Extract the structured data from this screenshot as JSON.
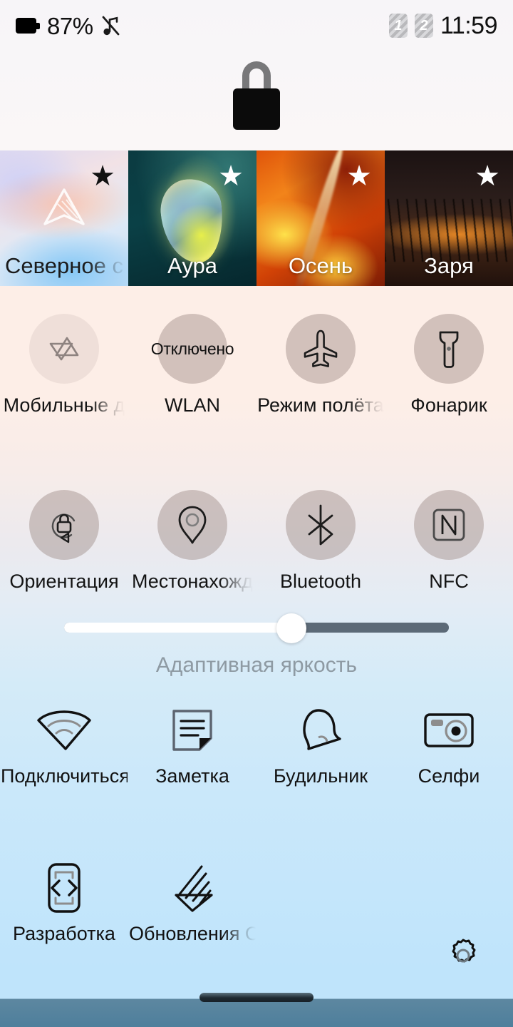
{
  "status_bar": {
    "battery_percent": "87%",
    "battery_icon": "battery-icon",
    "mute_icon": "music-muted-icon",
    "sim1": "1",
    "sim2": "2",
    "clock": "11:59"
  },
  "lock": {
    "icon": "lock-closed-icon"
  },
  "themes": [
    {
      "name": "Северное с",
      "star": "★",
      "star_color": "#121212",
      "label_color": "#1b1b1b",
      "truncated": true,
      "art": "aurora"
    },
    {
      "name": "Аура",
      "star": "★",
      "star_color": "#ffffff",
      "label_color": "#ffffff",
      "truncated": false,
      "art": "aura"
    },
    {
      "name": "Осень",
      "star": "★",
      "star_color": "#ffffff",
      "label_color": "#ffffff",
      "truncated": false,
      "art": "autumn"
    },
    {
      "name": "Заря",
      "star": "★",
      "star_color": "#ffffff",
      "label_color": "#ffffff",
      "truncated": false,
      "art": "dawn"
    }
  ],
  "toggles": [
    {
      "label": "Мобильные д",
      "icon": "mobile-data-icon",
      "state": "off",
      "truncated": true,
      "value_text": ""
    },
    {
      "label": "WLAN",
      "icon": "wlan-text-icon",
      "state": "on",
      "truncated": false,
      "value_text": "Отключено"
    },
    {
      "label": "Режим полёта",
      "icon": "airplane-icon",
      "state": "on",
      "truncated": true,
      "value_text": ""
    },
    {
      "label": "Фонарик",
      "icon": "flashlight-icon",
      "state": "on",
      "truncated": false,
      "value_text": ""
    },
    {
      "label": "Ориентация",
      "icon": "rotation-lock-icon",
      "state": "on",
      "truncated": false,
      "value_text": ""
    },
    {
      "label": "Местонахожд",
      "icon": "location-pin-icon",
      "state": "on",
      "truncated": true,
      "value_text": ""
    },
    {
      "label": "Bluetooth",
      "icon": "bluetooth-icon",
      "state": "on",
      "truncated": false,
      "value_text": ""
    },
    {
      "label": "NFC",
      "icon": "nfc-icon",
      "state": "on",
      "truncated": false,
      "value_text": ""
    }
  ],
  "brightness": {
    "label": "Адаптивная яркость",
    "value_percent": 59,
    "fill_color": "#ffffff",
    "track_color": "#5c6a77"
  },
  "shortcuts": [
    {
      "label": "Подключиться",
      "icon": "cast-wifi-icon",
      "truncated": false
    },
    {
      "label": "Заметка",
      "icon": "note-icon",
      "truncated": false
    },
    {
      "label": "Будильник",
      "icon": "alarm-bell-icon",
      "truncated": false
    },
    {
      "label": "Селфи",
      "icon": "camera-icon",
      "truncated": false
    },
    {
      "label": "Разработка",
      "icon": "developer-code-icon",
      "truncated": false
    },
    {
      "label": "Обновления О",
      "icon": "system-update-icon",
      "truncated": true
    }
  ],
  "settings_button": {
    "icon": "gear-icon"
  },
  "home_indicator": {
    "icon": "home-indicator"
  }
}
